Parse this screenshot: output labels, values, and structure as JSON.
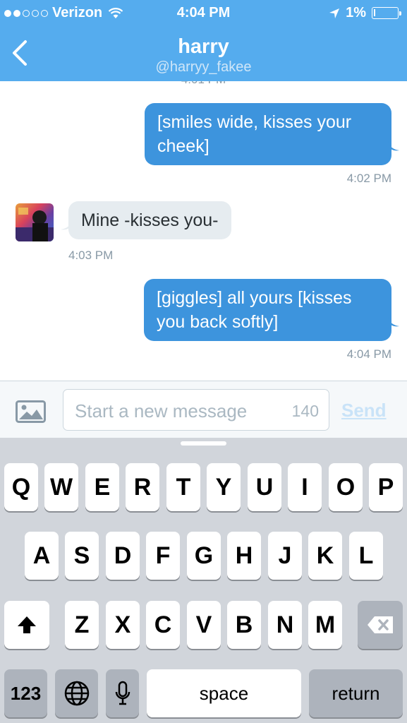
{
  "status_bar": {
    "carrier": "Verizon",
    "time": "4:04 PM",
    "battery": "1%"
  },
  "header": {
    "title": "harry",
    "handle": "@harryy_fakee"
  },
  "conversation": {
    "messages": [
      {
        "direction": "out",
        "text": "[smiles wide, kisses your cheek]",
        "time": "4:02 PM"
      },
      {
        "direction": "in",
        "text": "Mine -kisses you-",
        "time": "4:03 PM"
      },
      {
        "direction": "out",
        "text": "[giggles] all yours [kisses you back softly]",
        "time": "4:04 PM"
      }
    ]
  },
  "composer": {
    "placeholder": "Start a new message",
    "char_count": "140",
    "send_label": "Send"
  },
  "keyboard": {
    "row1": [
      "Q",
      "W",
      "E",
      "R",
      "T",
      "Y",
      "U",
      "I",
      "O",
      "P"
    ],
    "row2": [
      "A",
      "S",
      "D",
      "F",
      "G",
      "H",
      "J",
      "K",
      "L"
    ],
    "row3": [
      "Z",
      "X",
      "C",
      "V",
      "B",
      "N",
      "M"
    ],
    "numbers_label": "123",
    "space_label": "space",
    "return_label": "return"
  },
  "colors": {
    "header": "#55acee",
    "outgoing_bubble": "#3d94dd",
    "incoming_bubble": "#e6ecf0"
  }
}
